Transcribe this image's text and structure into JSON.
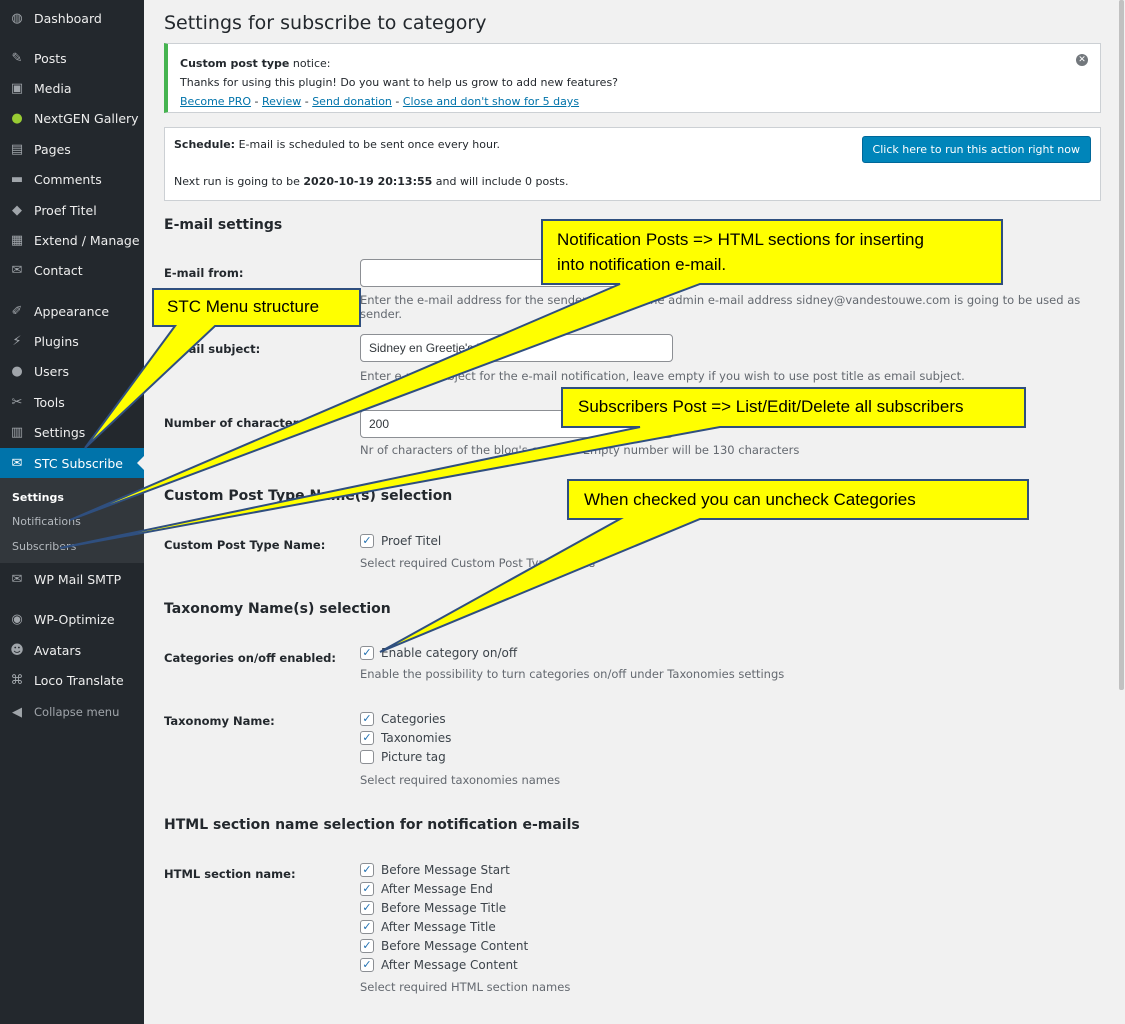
{
  "sidebar": {
    "items": [
      {
        "label": "Dashboard",
        "icon": "dashboard-icon"
      },
      {
        "label": "Posts",
        "icon": "pin-icon"
      },
      {
        "label": "Media",
        "icon": "media-icon"
      },
      {
        "label": "NextGEN Gallery",
        "icon": "gallery-icon"
      },
      {
        "label": "Pages",
        "icon": "pages-icon"
      },
      {
        "label": "Comments",
        "icon": "comment-icon"
      },
      {
        "label": "Proef Titel",
        "icon": "tag-icon"
      },
      {
        "label": "Extend / Manage",
        "icon": "extend-icon"
      },
      {
        "label": "Contact",
        "icon": "mail-icon"
      },
      {
        "label": "Appearance",
        "icon": "brush-icon"
      },
      {
        "label": "Plugins",
        "icon": "plugin-icon"
      },
      {
        "label": "Users",
        "icon": "user-icon"
      },
      {
        "label": "Tools",
        "icon": "wrench-icon"
      },
      {
        "label": "Settings",
        "icon": "settings-icon"
      },
      {
        "label": "STC Subscribe",
        "icon": "mail-icon"
      },
      {
        "label": "WP Mail SMTP",
        "icon": "mail-smtp-icon"
      },
      {
        "label": "WP-Optimize",
        "icon": "optimize-icon"
      },
      {
        "label": "Avatars",
        "icon": "avatar-icon"
      },
      {
        "label": "Loco Translate",
        "icon": "translate-icon"
      }
    ],
    "submenu": [
      "Settings",
      "Notifications",
      "Subscribers"
    ],
    "collapse": "Collapse menu"
  },
  "page": {
    "title": "Settings for subscribe to category"
  },
  "notice": {
    "title_bold": "Custom post type",
    "title_rest": " notice:",
    "message": "Thanks for using this plugin! Do you want to help us grow to add new features?",
    "links": [
      "Become PRO",
      "Review",
      "Send donation",
      "Close and don't show for 5 days"
    ],
    "sep": " - "
  },
  "schedule": {
    "label": "Schedule:",
    "text": " E-mail is scheduled to be sent once every hour.",
    "next_prefix": "Next run is going to be ",
    "next_time": "2020-10-19 20:13:55",
    "next_suffix": " and will include 0 posts.",
    "button": "Click here to run this action right now"
  },
  "email": {
    "heading": "E-mail settings",
    "from_label": "E-mail from:",
    "from_value": "",
    "from_desc": "Enter the e-mail address for the sender, if empty the admin e-mail address sidney@vandestouwe.com is going to be used as sender.",
    "subject_label": "E-mail subject:",
    "subject_value": "Sidney en Greetje's blog",
    "subject_desc": "Enter e-mail subject for the e-mail notification, leave empty if you wish to use post title as email subject.",
    "chars_label": "Number of characters:",
    "chars_value": "200",
    "chars_desc": "Nr of characters of the blog's content. Empty number will be 130 characters"
  },
  "cpt": {
    "heading": "Custom Post Type Name(s) selection",
    "label": "Custom Post Type Name:",
    "options": [
      {
        "label": "Proef Titel",
        "checked": true
      }
    ],
    "desc": "Select required Custom Post Type names"
  },
  "tax": {
    "heading": "Taxonomy Name(s) selection",
    "onoff_label": "Categories on/off enabled:",
    "onoff_option": "Enable category on/off",
    "onoff_checked": true,
    "onoff_desc": "Enable the possibility to turn categories on/off under Taxonomies settings",
    "name_label": "Taxonomy Name:",
    "options": [
      {
        "label": "Categories",
        "checked": true
      },
      {
        "label": "Taxonomies",
        "checked": true
      },
      {
        "label": "Picture tag",
        "checked": false
      }
    ],
    "desc": "Select required taxonomies names"
  },
  "html": {
    "heading": "HTML section name selection for notification e-mails",
    "label": "HTML section name:",
    "options": [
      {
        "label": "Before Message Start",
        "checked": true
      },
      {
        "label": "After Message End",
        "checked": true
      },
      {
        "label": "Before Message Title",
        "checked": true
      },
      {
        "label": "After Message Title",
        "checked": true
      },
      {
        "label": "Before Message Content",
        "checked": true
      },
      {
        "label": "After Message Content",
        "checked": true
      }
    ],
    "desc": "Select required HTML section names"
  },
  "callouts": {
    "menu": "STC Menu structure",
    "notif_1": "Notification Posts => HTML sections for inserting",
    "notif_2": "into notification e-mail.",
    "subs": "Subscribers Post => List/Edit/Delete all subscribers",
    "check": "When checked you can uncheck Categories",
    "fill": "#ffff00",
    "border": "#2f4f7f"
  }
}
